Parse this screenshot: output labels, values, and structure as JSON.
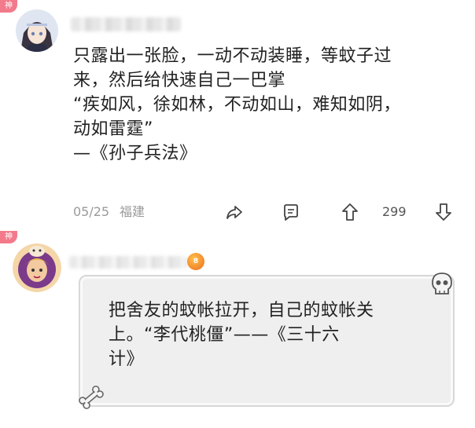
{
  "comment1": {
    "tag": "神",
    "text_lines": [
      "只露出一张脸，一动不动装睡，等蚊子过",
      "来，然后给快速自己一巴掌",
      "“疾如风，徐如林，不动如山，难知如阴，",
      "动如雷霆”",
      "—《孙子兵法》"
    ],
    "date": "05/25",
    "location": "福建",
    "like_count": "299",
    "icons": {
      "share": "share-icon",
      "reply": "comment-icon",
      "upvote": "arrow-up-icon",
      "downvote": "arrow-down-icon"
    }
  },
  "comment2": {
    "tag": "神",
    "badge": "8",
    "text_lines": [
      "把舍友的蚊帐拉开，自己的蚊帐关",
      "上。“李代桃僵”——《三十六",
      "计》"
    ],
    "decorations": [
      "skull-icon",
      "bone-icon"
    ]
  },
  "colors": {
    "tag_pink": "#f27a8a",
    "meta_gray": "#9a9a9a",
    "bubble_bg": "#efefef"
  }
}
